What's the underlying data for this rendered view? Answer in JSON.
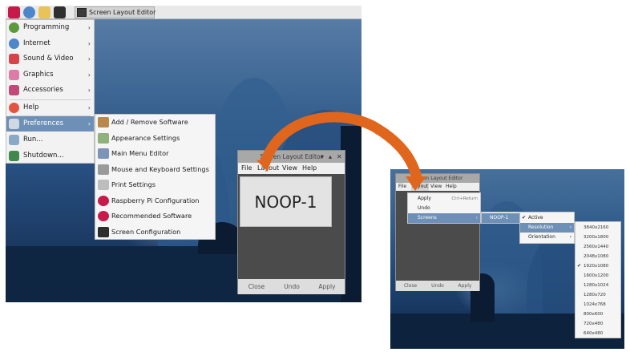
{
  "taskbar": {
    "icons": [
      "raspberry-icon",
      "globe-icon",
      "folder-icon",
      "terminal-icon"
    ],
    "task_label": "Screen Layout Editor"
  },
  "main_menu": {
    "items": [
      {
        "label": "Programming",
        "icon": "programming-icon",
        "has_submenu": true
      },
      {
        "label": "Internet",
        "icon": "globe-icon",
        "has_submenu": true
      },
      {
        "label": "Sound & Video",
        "icon": "sound-video-icon",
        "has_submenu": true
      },
      {
        "label": "Graphics",
        "icon": "graphics-icon",
        "has_submenu": true
      },
      {
        "label": "Accessories",
        "icon": "accessories-icon",
        "has_submenu": true
      },
      {
        "label": "Help",
        "icon": "help-icon",
        "has_submenu": true
      },
      {
        "label": "Preferences",
        "icon": "preferences-icon",
        "has_submenu": true,
        "selected": true
      },
      {
        "label": "Run...",
        "icon": "run-icon",
        "has_submenu": false
      },
      {
        "label": "Shutdown...",
        "icon": "shutdown-icon",
        "has_submenu": false
      }
    ],
    "arrow": "›"
  },
  "preferences_menu": {
    "items": [
      {
        "label": "Add / Remove Software",
        "icon": "package-icon"
      },
      {
        "label": "Appearance Settings",
        "icon": "appearance-icon"
      },
      {
        "label": "Main Menu Editor",
        "icon": "menu-editor-icon"
      },
      {
        "label": "Mouse and Keyboard Settings",
        "icon": "keyboard-icon"
      },
      {
        "label": "Print Settings",
        "icon": "printer-icon"
      },
      {
        "label": "Raspberry Pi Configuration",
        "icon": "raspberry-icon"
      },
      {
        "label": "Recommended Software",
        "icon": "raspberry-icon"
      },
      {
        "label": "Screen Configuration",
        "icon": "monitor-icon"
      }
    ]
  },
  "editor_window": {
    "title": "Screen Layout Editor",
    "controls": [
      "▾",
      "▴",
      "✕"
    ],
    "menubar": [
      "File",
      "Layout",
      "View",
      "Help"
    ],
    "display_label": "NOOP-1",
    "buttons": [
      "Close",
      "Undo",
      "Apply"
    ]
  },
  "zoom_view": {
    "title": "Screen Layout Editor",
    "menubar": [
      "File",
      "Layout",
      "View",
      "Help"
    ],
    "layout_menu": [
      {
        "label": "Apply",
        "shortcut": "Ctrl+Return"
      },
      {
        "label": "Undo",
        "shortcut": ""
      },
      {
        "label": "Screens",
        "shortcut": "›",
        "selected": true
      }
    ],
    "screens_menu": [
      {
        "label": "NOOP-1",
        "arrow": "›",
        "selected": true
      }
    ],
    "output_menu": [
      {
        "label": "Active",
        "checked": true,
        "arrow": ""
      },
      {
        "label": "Resolution",
        "checked": false,
        "arrow": "›",
        "selected": true
      },
      {
        "label": "Orientation",
        "checked": false,
        "arrow": "›"
      }
    ],
    "checkmark": "✔",
    "resolutions": [
      "3840x2160",
      "3200x1800",
      "2560x1440",
      "2048x1080",
      "1920x1080",
      "1600x1200",
      "1280x1024",
      "1280x720",
      "1024x768",
      "800x600",
      "720x480",
      "640x480"
    ],
    "selected_resolution": "1920x1080",
    "buttons": [
      "Close",
      "Undo",
      "Apply"
    ]
  },
  "colors": {
    "menu_highlight": "#6e8fb6",
    "arrow": "#e0661d",
    "wallpaper": "#274f80"
  }
}
